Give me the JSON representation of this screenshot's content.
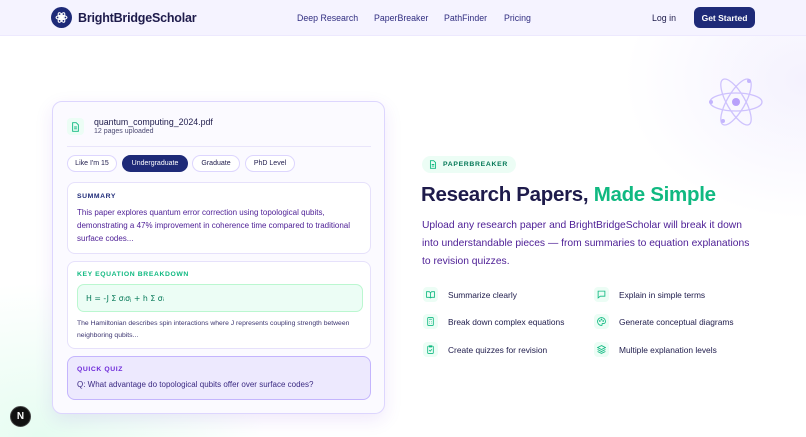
{
  "nav": {
    "brand": "BrightBridgeScholar",
    "links": [
      "Deep Research",
      "PaperBreaker",
      "PathFinder",
      "Pricing"
    ],
    "login": "Log in",
    "cta": "Get Started"
  },
  "demo_card": {
    "file_name": "quantum_computing_2024.pdf",
    "file_meta": "12 pages uploaded",
    "levels": [
      "Like I'm 15",
      "Undergraduate",
      "Graduate",
      "PhD Level"
    ],
    "active_level": "Undergraduate",
    "summary": {
      "title": "SUMMARY",
      "text": "This paper explores quantum error correction using topological qubits, demonstrating a 47% improvement in coherence time compared to traditional surface codes..."
    },
    "equation": {
      "title": "KEY EQUATION BREAKDOWN",
      "formula": "H = -J Σ σᵢσⱼ + h Σ σᵢ",
      "text": "The Hamiltonian describes spin interactions where J represents coupling strength between neighboring qubits..."
    },
    "quiz": {
      "title": "QUICK QUIZ",
      "question": "Q: What advantage do topological qubits offer over surface codes?"
    }
  },
  "hero": {
    "badge": "PAPERBREAKER",
    "headline_main": "Research Papers, ",
    "headline_accent": "Made Simple",
    "description": "Upload any research paper and BrightBridgeScholar will break it down into understandable pieces — from summaries to equation explanations to revision quizzes.",
    "features": [
      {
        "icon": "book-icon",
        "label": "Summarize clearly"
      },
      {
        "icon": "chat-icon",
        "label": "Explain in simple terms"
      },
      {
        "icon": "calculator-icon",
        "label": "Break down complex equations"
      },
      {
        "icon": "palette-icon",
        "label": "Generate conceptual diagrams"
      },
      {
        "icon": "clipboard-check-icon",
        "label": "Create quizzes for revision"
      },
      {
        "icon": "layers-icon",
        "label": "Multiple explanation levels"
      }
    ]
  },
  "colors": {
    "primary": "#1e2a78",
    "accent_green": "#10b981",
    "text_dark": "#1e1b4b",
    "text_purple": "#4c1d95"
  },
  "badge_letter": "N"
}
